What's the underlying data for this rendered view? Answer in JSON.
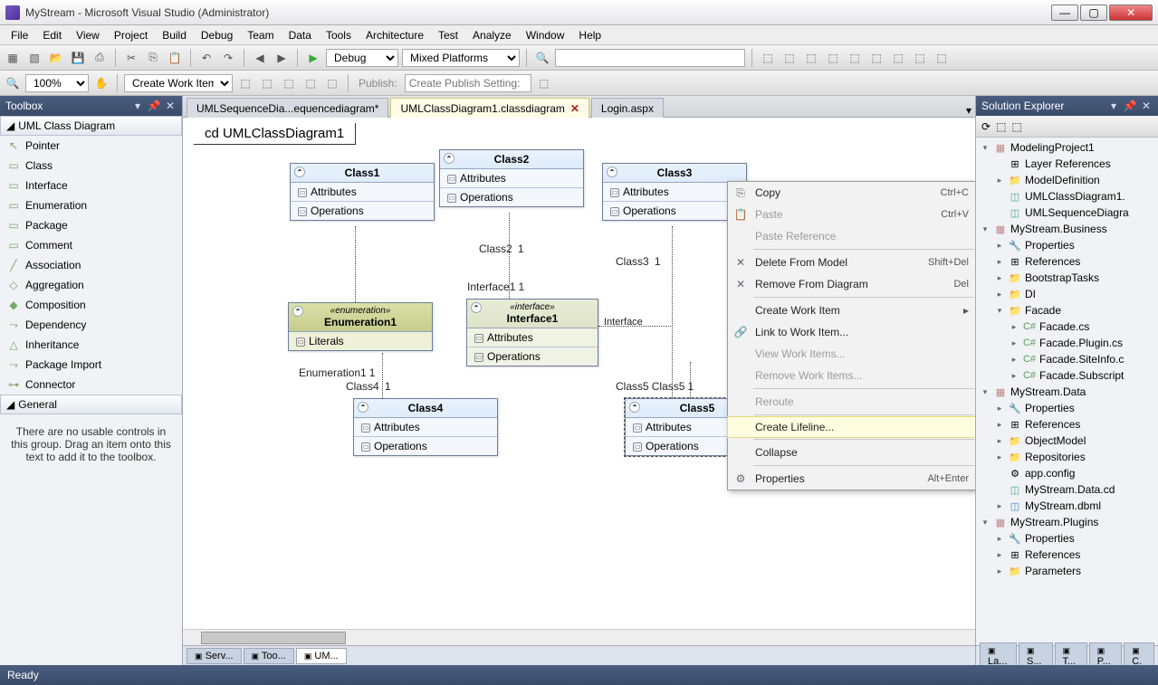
{
  "titlebar": {
    "title": "MyStream - Microsoft Visual Studio (Administrator)"
  },
  "menu": [
    "File",
    "Edit",
    "View",
    "Project",
    "Build",
    "Debug",
    "Team",
    "Data",
    "Tools",
    "Architecture",
    "Test",
    "Analyze",
    "Window",
    "Help"
  ],
  "toolbar1": {
    "config": "Debug",
    "platform": "Mixed Platforms"
  },
  "toolbar2": {
    "zoom": "100%",
    "workitem": "Create Work Item",
    "publish_lbl": "Publish:",
    "publish_ph": "Create Publish Setting:"
  },
  "toolbox": {
    "title": "Toolbox",
    "cat1": "UML Class Diagram",
    "items": [
      "Pointer",
      "Class",
      "Interface",
      "Enumeration",
      "Package",
      "Comment",
      "Association",
      "Aggregation",
      "Composition",
      "Dependency",
      "Inheritance",
      "Package Import",
      "Connector"
    ],
    "cat2": "General",
    "msg": "There are no usable controls in this group. Drag an item onto this text to add it to the toolbox."
  },
  "tabs": [
    {
      "label": "UMLSequenceDia...equencediagram*",
      "active": false
    },
    {
      "label": "UMLClassDiagram1.classdiagram",
      "active": true
    },
    {
      "label": "Login.aspx",
      "active": false
    }
  ],
  "diagram": {
    "title": "cd UMLClassDiagram1",
    "attr": "Attributes",
    "ops": "Operations",
    "lit": "Literals",
    "class1": "Class1",
    "class2": "Class2",
    "class3": "Class3",
    "class4": "Class4",
    "class5": "Class5",
    "enum": "Enumeration1",
    "enum_s": "«enumeration»",
    "iface": "Interface1",
    "iface_s": "«interface»",
    "l_class2": "Class2",
    "l_class3": "Class3",
    "l_class4": "Class4",
    "l_class5": "Class5",
    "l_class5b": "Class5",
    "l_iface1": "Interface1",
    "l_iface": "Interface",
    "l_enum": "Enumeration1",
    "one": "1"
  },
  "ctx": [
    {
      "t": "item",
      "label": "Copy",
      "sc": "Ctrl+C",
      "ic": "⎘"
    },
    {
      "t": "item",
      "label": "Paste",
      "sc": "Ctrl+V",
      "dis": true,
      "ic": "📋"
    },
    {
      "t": "item",
      "label": "Paste Reference",
      "dis": true
    },
    {
      "t": "sep"
    },
    {
      "t": "item",
      "label": "Delete From Model",
      "sc": "Shift+Del",
      "ic": "✕"
    },
    {
      "t": "item",
      "label": "Remove From Diagram",
      "sc": "Del",
      "ic": "✕"
    },
    {
      "t": "sep"
    },
    {
      "t": "item",
      "label": "Create Work Item",
      "sub": true
    },
    {
      "t": "item",
      "label": "Link to Work Item...",
      "ic": "🔗"
    },
    {
      "t": "item",
      "label": "View Work Items...",
      "dis": true
    },
    {
      "t": "item",
      "label": "Remove Work Items...",
      "dis": true
    },
    {
      "t": "sep"
    },
    {
      "t": "item",
      "label": "Reroute",
      "dis": true
    },
    {
      "t": "sep"
    },
    {
      "t": "item",
      "label": "Create Lifeline...",
      "hl": true
    },
    {
      "t": "sep"
    },
    {
      "t": "item",
      "label": "Collapse"
    },
    {
      "t": "sep"
    },
    {
      "t": "item",
      "label": "Properties",
      "sc": "Alt+Enter",
      "ic": "⚙"
    }
  ],
  "solx": {
    "title": "Solution Explorer",
    "tree": [
      {
        "d": 0,
        "exp": "▾",
        "ic": "proj",
        "t": "ModelingProject1"
      },
      {
        "d": 1,
        "ic": "ref",
        "t": "Layer References"
      },
      {
        "d": 1,
        "exp": "▸",
        "ic": "fld",
        "t": "ModelDefinition"
      },
      {
        "d": 1,
        "ic": "uml",
        "t": "UMLClassDiagram1."
      },
      {
        "d": 1,
        "ic": "uml",
        "t": "UMLSequenceDiagra"
      },
      {
        "d": 0,
        "exp": "▾",
        "ic": "proj",
        "t": "MyStream.Business"
      },
      {
        "d": 1,
        "exp": "▸",
        "ic": "prop",
        "t": "Properties"
      },
      {
        "d": 1,
        "exp": "▸",
        "ic": "ref",
        "t": "References"
      },
      {
        "d": 1,
        "exp": "▸",
        "ic": "fld",
        "t": "BootstrapTasks"
      },
      {
        "d": 1,
        "exp": "▸",
        "ic": "fld",
        "t": "DI"
      },
      {
        "d": 1,
        "exp": "▾",
        "ic": "fld",
        "t": "Facade"
      },
      {
        "d": 2,
        "exp": "▸",
        "ic": "cs",
        "t": "Facade.cs"
      },
      {
        "d": 2,
        "exp": "▸",
        "ic": "cs",
        "t": "Facade.Plugin.cs"
      },
      {
        "d": 2,
        "exp": "▸",
        "ic": "cs",
        "t": "Facade.SiteInfo.c"
      },
      {
        "d": 2,
        "exp": "▸",
        "ic": "cs",
        "t": "Facade.Subscript"
      },
      {
        "d": 0,
        "exp": "▾",
        "ic": "proj",
        "t": "MyStream.Data"
      },
      {
        "d": 1,
        "exp": "▸",
        "ic": "prop",
        "t": "Properties"
      },
      {
        "d": 1,
        "exp": "▸",
        "ic": "ref",
        "t": "References"
      },
      {
        "d": 1,
        "exp": "▸",
        "ic": "fld",
        "t": "ObjectModel"
      },
      {
        "d": 1,
        "exp": "▸",
        "ic": "fld",
        "t": "Repositories"
      },
      {
        "d": 1,
        "ic": "cfg",
        "t": "app.config"
      },
      {
        "d": 1,
        "ic": "uml",
        "t": "MyStream.Data.cd"
      },
      {
        "d": 1,
        "exp": "▸",
        "ic": "db",
        "t": "MyStream.dbml"
      },
      {
        "d": 0,
        "exp": "▾",
        "ic": "proj",
        "t": "MyStream.Plugins"
      },
      {
        "d": 1,
        "exp": "▸",
        "ic": "prop",
        "t": "Properties"
      },
      {
        "d": 1,
        "exp": "▸",
        "ic": "ref",
        "t": "References"
      },
      {
        "d": 1,
        "exp": "▸",
        "ic": "fld",
        "t": "Parameters"
      }
    ]
  },
  "bottomtabs_left": [
    "Serv...",
    "Too...",
    "UM..."
  ],
  "bottomtabs_right": [
    "La...",
    "S...",
    "T...",
    "P...",
    "C."
  ],
  "status": "Ready"
}
